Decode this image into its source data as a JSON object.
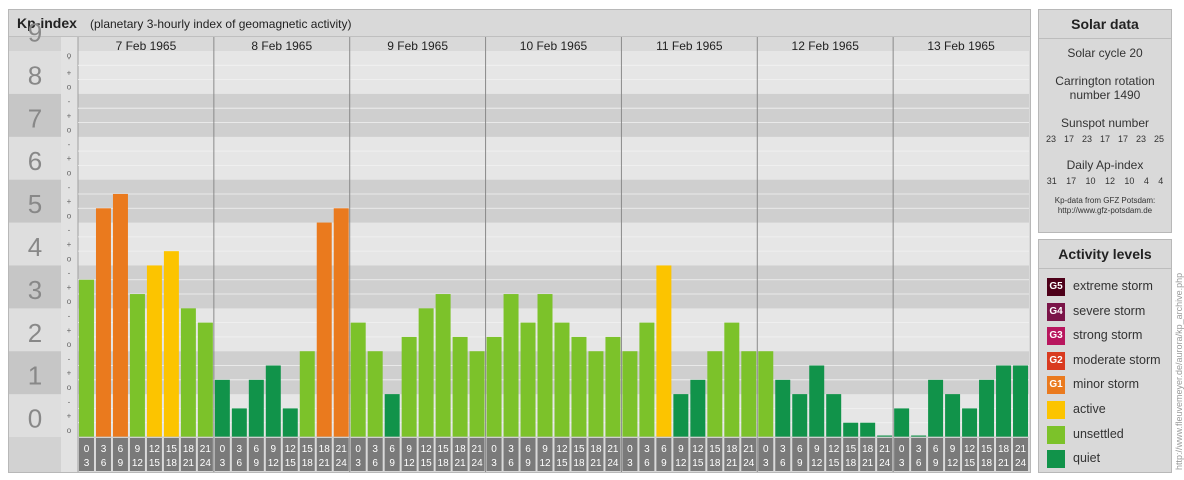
{
  "header": {
    "title": "Kp-index",
    "subtitle": "(planetary 3-hourly index of geomagnetic activity)"
  },
  "chart_data": {
    "type": "bar",
    "ylim": [
      0,
      9
    ],
    "y_ticks": [
      "0",
      "1",
      "2",
      "3",
      "4",
      "5",
      "6",
      "7",
      "8",
      "9"
    ],
    "sub_ticks": [
      "o",
      "+",
      "-"
    ],
    "days": [
      "7 Feb 1965",
      "8 Feb 1965",
      "9 Feb 1965",
      "10 Feb 1965",
      "11 Feb 1965",
      "12 Feb 1965",
      "13 Feb 1965"
    ],
    "hour_start": [
      "0",
      "3",
      "6",
      "9",
      "12",
      "15",
      "18",
      "21"
    ],
    "hour_end": [
      "3",
      "6",
      "9",
      "12",
      "15",
      "18",
      "21",
      "24"
    ],
    "values": [
      [
        3.667,
        5.333,
        5.667,
        3.333,
        4.0,
        4.333,
        3.0,
        2.667
      ],
      [
        1.333,
        0.667,
        1.333,
        1.667,
        0.667,
        2.0,
        5.0,
        5.333
      ],
      [
        2.667,
        2.0,
        1.0,
        2.333,
        3.0,
        3.333,
        2.333,
        2.0
      ],
      [
        2.333,
        3.333,
        2.667,
        3.333,
        2.667,
        2.333,
        2.0,
        2.333
      ],
      [
        2.0,
        2.667,
        4.0,
        1.0,
        1.333,
        2.0,
        2.667,
        2.0
      ],
      [
        2.0,
        1.333,
        1.0,
        1.667,
        1.0,
        0.333,
        0.333,
        0.0
      ],
      [
        0.667,
        0.0,
        1.333,
        1.0,
        0.667,
        1.333,
        1.667,
        1.667
      ]
    ],
    "color_rule": {
      "quiet": "<2",
      "unsettled": "2-3.67",
      "active": "4-4.67",
      "minor_storm": "5",
      "moderate_storm": "6"
    }
  },
  "solar_data": {
    "title": "Solar data",
    "solar_cycle": "Solar cycle 20",
    "carrington_line1": "Carrington rotation",
    "carrington_line2": "number 1490",
    "sunspot_title": "Sunspot number",
    "sunspot_values": [
      "23",
      "17",
      "23",
      "17",
      "17",
      "23",
      "25"
    ],
    "ap_title": "Daily Ap-index",
    "ap_values": [
      "31",
      "17",
      "10",
      "12",
      "10",
      "4",
      "4"
    ],
    "credit_line1": "Kp-data from GFZ Potsdam:",
    "credit_line2": "http://www.gfz-potsdam.de"
  },
  "activity_levels": {
    "title": "Activity levels",
    "items": [
      {
        "badge": "G5",
        "label": "extreme storm",
        "color": "#4d0019"
      },
      {
        "badge": "G4",
        "label": "severe storm",
        "color": "#7a1448"
      },
      {
        "badge": "G3",
        "label": "strong storm",
        "color": "#b8165e"
      },
      {
        "badge": "G2",
        "label": "moderate storm",
        "color": "#d93a1f"
      },
      {
        "badge": "G1",
        "label": "minor storm",
        "color": "#ea7a1e"
      },
      {
        "badge": "",
        "label": "active",
        "color": "#fcc400"
      },
      {
        "badge": "",
        "label": "unsettled",
        "color": "#7cc22a"
      },
      {
        "badge": "",
        "label": "quiet",
        "color": "#11934a"
      }
    ]
  },
  "watermark": "http://www.fleuvemeyer.de/aurora/kp_archive.php"
}
